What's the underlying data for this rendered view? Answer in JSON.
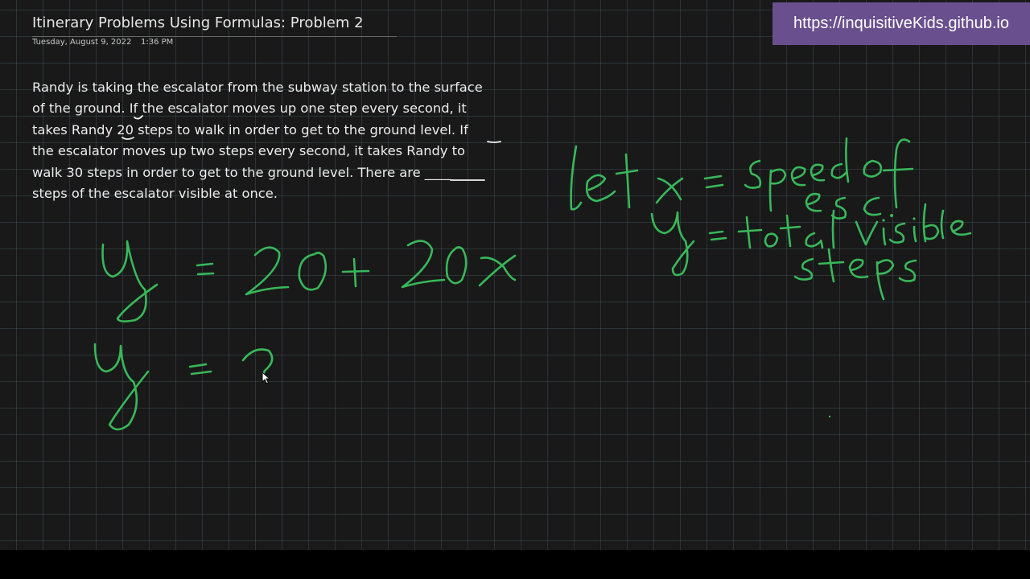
{
  "url_banner": {
    "text": "https://inquisitiveKids.github.io"
  },
  "page": {
    "title": "Itinerary Problems Using Formulas: Problem 2",
    "date": "Tuesday, August 9, 2022",
    "time": "1:36 PM"
  },
  "problem": {
    "lines": [
      "Randy is taking the escalator from the subway station to the surface",
      "of the ground. If the escalator moves up one step every second, it",
      "takes Randy 20 steps to walk in order to get to the ground level. If",
      "the escalator moves up two steps every second, it takes Randy to",
      "walk 30 steps in order to get to the ground level. There are ____",
      "steps of the escalator visible at once."
    ]
  },
  "handwriting": {
    "equation_1": "y = 20 + 20x",
    "equation_2": "y = ?",
    "definitions": [
      "let x = speed of esc.",
      "y = total visible steps"
    ],
    "ink_color": "#38b85a"
  },
  "colors": {
    "canvas_background": "#191919",
    "grid_line": "#4a5a60",
    "banner": "#6a4f8e"
  }
}
